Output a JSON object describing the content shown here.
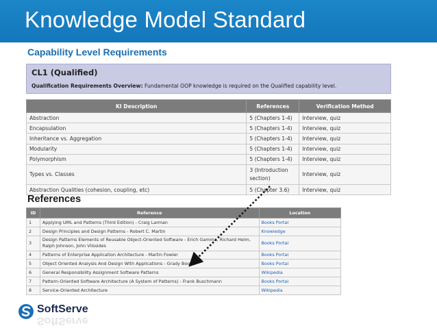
{
  "slide": {
    "title": "Knowledge Model Standard",
    "section_capability": "Capability Level Requirements",
    "section_references": "References"
  },
  "level": {
    "name": "CL1 (Qualified)",
    "overview_label": "Qualification Requirements Overview:",
    "overview_text": " Fundamental OOP knowledge is required on the Qualified capability level."
  },
  "ki_table": {
    "headers": [
      "KI Description",
      "References",
      "Verification Method"
    ],
    "rows": [
      {
        "description": "Abstraction",
        "references": "5 (Chapters 1-4)",
        "method": "Interview, quiz"
      },
      {
        "description": "Encapsulation",
        "references": "5 (Chapters 1-4)",
        "method": "Interview, quiz"
      },
      {
        "description": "Inheritance vs. Aggregation",
        "references": "5 (Chapters 1-4)",
        "method": "Interview, quiz"
      },
      {
        "description": "Modularity",
        "references": "5 (Chapters 1-4)",
        "method": "Interview, quiz"
      },
      {
        "description": "Polymorphism",
        "references": "5 (Chapters 1-4)",
        "method": "Interview, quiz"
      },
      {
        "description": "Types vs. Classes",
        "references": "3 (Introduction section)",
        "method": "Interview, quiz"
      },
      {
        "description": "Abstraction Qualities (cohesion, coupling, etc)",
        "references": "5 (Chapter 3.6)",
        "method": "Interview, quiz"
      }
    ]
  },
  "ref_table": {
    "headers": [
      "ID",
      "Reference",
      "Location"
    ],
    "rows": [
      {
        "id": "1",
        "reference": "Applying UML and Patterns (Third Edition) - Craig Larman",
        "location": "Books Portal"
      },
      {
        "id": "2",
        "reference": "Design Principles and Design Patterns - Robert C. Martin",
        "location": "Knowledge"
      },
      {
        "id": "3",
        "reference": "Design Patterns Elements of Reusable Object-Oriented Software - Erich Gamma, Richard Helm, Ralph Johnson, John Vlissides",
        "location": "Books Portal"
      },
      {
        "id": "4",
        "reference": "Patterns of Enterprise Application Architecture - Martin Fowler",
        "location": "Books Portal"
      },
      {
        "id": "5",
        "reference": "Object Oriented Analysis And Design With Applications - Grady Booch",
        "location": "Books Portal"
      },
      {
        "id": "6",
        "reference": "General Responsibility Assignment Software Patterns",
        "location": "Wikipedia"
      },
      {
        "id": "7",
        "reference": "Pattern-Oriented Software Architecture (A System of Patterns) - Frank Buschmann",
        "location": "Books Portal"
      },
      {
        "id": "8",
        "reference": "Service-Oriented Architecture",
        "location": "Wikipedia"
      }
    ]
  },
  "logo": {
    "name": "SoftServe"
  },
  "colors": {
    "title_bar": "#1477bb",
    "heading_blue": "#1a6fb0",
    "link_blue": "#1a5fb4",
    "header_gray": "#7c7c7c"
  }
}
